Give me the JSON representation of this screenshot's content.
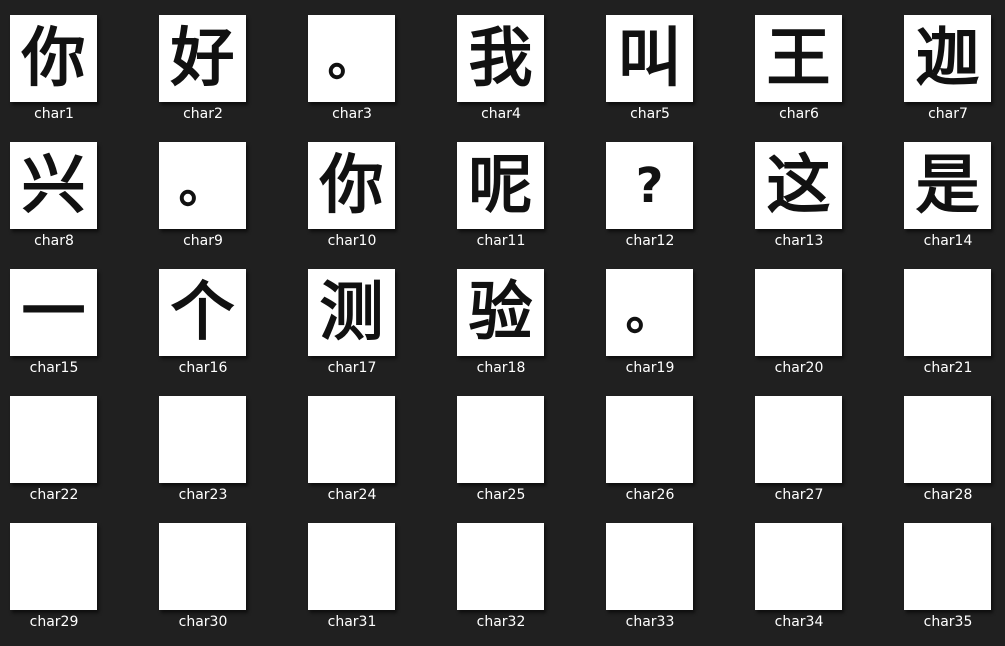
{
  "files": [
    {
      "name": "char1",
      "glyph": "你"
    },
    {
      "name": "char2",
      "glyph": "好"
    },
    {
      "name": "char3",
      "glyph": "。"
    },
    {
      "name": "char4",
      "glyph": "我"
    },
    {
      "name": "char5",
      "glyph": "叫"
    },
    {
      "name": "char6",
      "glyph": "王"
    },
    {
      "name": "char7",
      "glyph": "迦"
    },
    {
      "name": "char8",
      "glyph": "兴"
    },
    {
      "name": "char9",
      "glyph": "。"
    },
    {
      "name": "char10",
      "glyph": "你"
    },
    {
      "name": "char11",
      "glyph": "呢"
    },
    {
      "name": "char12",
      "glyph": "?"
    },
    {
      "name": "char13",
      "glyph": "这"
    },
    {
      "name": "char14",
      "glyph": "是"
    },
    {
      "name": "char15",
      "glyph": "一"
    },
    {
      "name": "char16",
      "glyph": "个"
    },
    {
      "name": "char17",
      "glyph": "测"
    },
    {
      "name": "char18",
      "glyph": "验"
    },
    {
      "name": "char19",
      "glyph": "。"
    },
    {
      "name": "char20",
      "glyph": ""
    },
    {
      "name": "char21",
      "glyph": ""
    },
    {
      "name": "char22",
      "glyph": ""
    },
    {
      "name": "char23",
      "glyph": ""
    },
    {
      "name": "char24",
      "glyph": ""
    },
    {
      "name": "char25",
      "glyph": ""
    },
    {
      "name": "char26",
      "glyph": ""
    },
    {
      "name": "char27",
      "glyph": ""
    },
    {
      "name": "char28",
      "glyph": ""
    },
    {
      "name": "char29",
      "glyph": ""
    },
    {
      "name": "char30",
      "glyph": ""
    },
    {
      "name": "char31",
      "glyph": ""
    },
    {
      "name": "char32",
      "glyph": ""
    },
    {
      "name": "char33",
      "glyph": ""
    },
    {
      "name": "char34",
      "glyph": ""
    },
    {
      "name": "char35",
      "glyph": ""
    }
  ]
}
